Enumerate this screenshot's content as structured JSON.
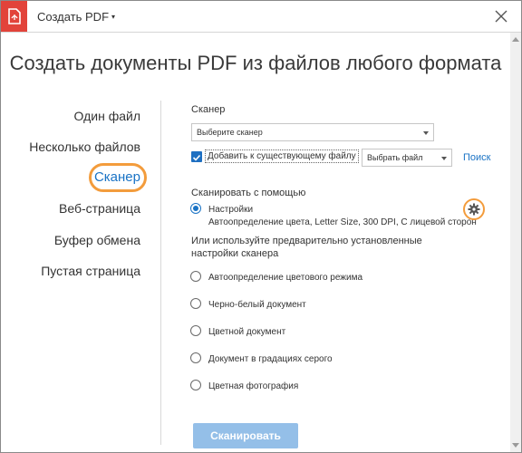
{
  "window": {
    "title": "Создать PDF",
    "title_caret": "▾"
  },
  "heading": "Создать документы PDF из файлов любого формата",
  "nav": {
    "items": [
      {
        "label": "Один файл"
      },
      {
        "label": "Несколько файлов"
      },
      {
        "label": "Сканер",
        "active": true
      },
      {
        "label": "Веб-страница"
      },
      {
        "label": "Буфер обмена"
      },
      {
        "label": "Пустая страница"
      }
    ]
  },
  "scanner": {
    "section_label": "Сканер",
    "scanner_select": "Выберите сканер",
    "add_to_existing": {
      "label": "Добавить к существующему файлу",
      "checked": true
    },
    "file_select": "Выбрать файл",
    "search_link": "Поиск"
  },
  "scan_with": {
    "label": "Сканировать с помощью",
    "settings_option": {
      "label": "Настройки",
      "detail": "Автоопределение цвета, Letter Size, 300 DPI, С лицевой сторон",
      "checked": true
    },
    "presets_label_1": "Или используйте предварительно установленные",
    "presets_label_2": "настройки сканера",
    "presets": [
      {
        "label": "Автоопределение цветового режима"
      },
      {
        "label": "Черно-белый документ"
      },
      {
        "label": "Цветной документ"
      },
      {
        "label": "Документ в градациях серого"
      },
      {
        "label": "Цветная фотография"
      }
    ]
  },
  "scan_button": "Сканировать",
  "colors": {
    "accent_blue": "#1a73c5",
    "highlight_orange": "#f39c3c",
    "app_red": "#e2433a",
    "disabled_button": "#94bfe8"
  }
}
